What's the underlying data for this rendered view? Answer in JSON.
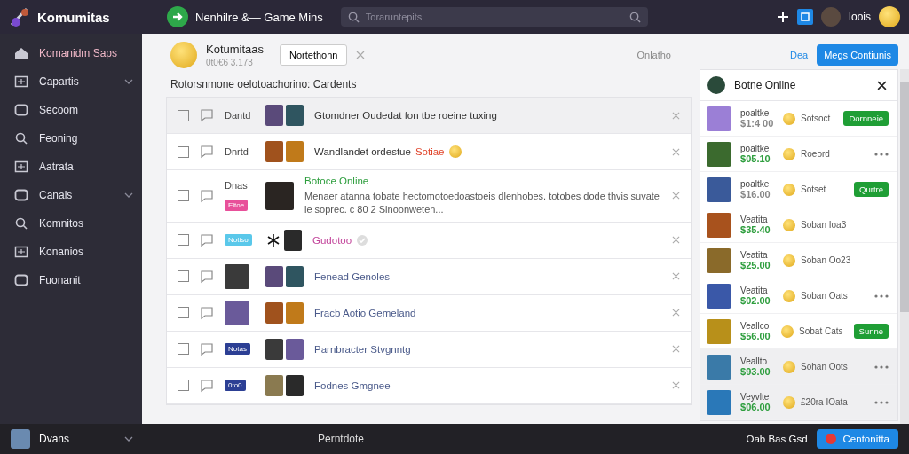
{
  "topbar": {
    "brand": "Komumitas",
    "title": "Nenhilre &— Game Mins",
    "search": {
      "placeholder": "Toraruntepits"
    },
    "user": "Ioois"
  },
  "sidebar": {
    "items": [
      {
        "label": "Komanidm Saps",
        "selected": true,
        "expandable": false
      },
      {
        "label": "Capartis",
        "selected": false,
        "expandable": true
      },
      {
        "label": "Secoom",
        "selected": false,
        "expandable": false
      },
      {
        "label": "Feoning",
        "selected": false,
        "expandable": false
      },
      {
        "label": "Aatrata",
        "selected": false,
        "expandable": false
      },
      {
        "label": "Canais",
        "selected": false,
        "expandable": true
      },
      {
        "label": "Komnitos",
        "selected": false,
        "expandable": false
      },
      {
        "label": "Konanios",
        "selected": false,
        "expandable": false
      },
      {
        "label": "Fuonanit",
        "selected": false,
        "expandable": false
      }
    ]
  },
  "header": {
    "name": "Kotumitaas",
    "subtitle": "0t0€6 3.173",
    "button": "Nortethonn",
    "status": "Onlatho",
    "link": "Dea",
    "primary_button": "Megs Contiunis",
    "description": "Rotorsnmone oelotoachorino: Cardents"
  },
  "rows": [
    {
      "selected": true,
      "checked": false,
      "label": "Dantd",
      "thumbs": [
        {
          "kind": "photo"
        },
        {
          "kind": "photo"
        }
      ],
      "title": "Gtomdner Oudedat fon tbe roeine tuxing",
      "color": "#333333"
    },
    {
      "selected": false,
      "checked": false,
      "label": "Dnrtd",
      "thumbs": [
        {
          "kind": "photo"
        },
        {
          "kind": "photo"
        }
      ],
      "title": "Wandlandet ordestue",
      "highlight": "Sotiae",
      "badge": {
        "kind": "coin"
      },
      "color": "#333333"
    },
    {
      "selected": false,
      "checked": false,
      "label": "Dnas",
      "tag": {
        "text": "Eltoe",
        "color": "#e8509a"
      },
      "thumbs": [
        {
          "kind": "portrait"
        }
      ],
      "title": "Botoce Online",
      "description": "Menaer atanna tobate hectomotoedoastoeis dlenhobes. totobes dode thvis suvate le soprec. c 80 2 Slnoonweten...",
      "color": "#2e9e3e"
    },
    {
      "selected": false,
      "checked": false,
      "tag": {
        "text": "Notiso",
        "color": "#5ac8ea"
      },
      "thumbs": [
        {
          "kind": "asterisk"
        },
        {
          "kind": "photo"
        }
      ],
      "title": "Gudotoo",
      "badge": {
        "kind": "check"
      },
      "color": "#c2439a"
    },
    {
      "selected": false,
      "checked": false,
      "avatar": true,
      "thumbs": [
        {
          "kind": "photo"
        },
        {
          "kind": "photo"
        }
      ],
      "title": "Fenead Genoles",
      "color": "#4a5a8a"
    },
    {
      "selected": false,
      "checked": false,
      "avatar": true,
      "thumbs": [
        {
          "kind": "photo"
        },
        {
          "kind": "photo"
        }
      ],
      "title": "Fracb Aotio Gemeland",
      "color": "#4a5a8a"
    },
    {
      "selected": false,
      "checked": false,
      "tag": {
        "text": "Notas",
        "color": "#2c3f94"
      },
      "thumbs": [
        {
          "kind": "photo"
        },
        {
          "kind": "photo"
        }
      ],
      "title": "Parnbracter Stvgnntg",
      "color": "#4a5a8a"
    },
    {
      "selected": false,
      "checked": false,
      "tag": {
        "text": "0to0",
        "color": "#2c3f94"
      },
      "thumbs": [
        {
          "kind": "photo"
        },
        {
          "kind": "photo"
        }
      ],
      "title": "Fodnes Gmgnee",
      "color": "#4a5a8a"
    }
  ],
  "panel": {
    "title": "Botne Online",
    "items": [
      {
        "name": "poaltke",
        "price": "$1:4 00",
        "color": "#888888",
        "coin": "Sotsoct",
        "kind": "button",
        "button_label": "Dornneie",
        "highlighted": false
      },
      {
        "name": "poaltke",
        "price": "$05.10",
        "color": "#2e9e3e",
        "coin": "Roeord",
        "kind": "more",
        "highlighted": false
      },
      {
        "name": "poaltke",
        "price": "$16.00",
        "color": "#888888",
        "coin": "Sotset",
        "kind": "button",
        "button_label": "Qurtre",
        "highlighted": false
      },
      {
        "name": "Veatita",
        "price": "$35.40",
        "color": "#2e9e3e",
        "coin": "Soban Ioa3",
        "kind": "plain",
        "highlighted": false
      },
      {
        "name": "Veatita",
        "price": "$25.00",
        "color": "#2e9e3e",
        "coin": "Soban Oo23",
        "kind": "plain",
        "highlighted": false
      },
      {
        "name": "Veatita",
        "price": "$02.00",
        "color": "#2e9e3e",
        "coin": "Soban Oats",
        "kind": "more",
        "highlighted": false
      },
      {
        "name": "Veallco",
        "price": "$56.00",
        "color": "#2e9e3e",
        "coin": "Sobat Cats",
        "kind": "button",
        "button_label": "Sunne",
        "highlighted": false
      },
      {
        "name": "Veallto",
        "price": "$93.00",
        "color": "#2e9e3e",
        "coin": "Sohan Oots",
        "kind": "more",
        "highlighted": true
      },
      {
        "name": "Veyvlte",
        "price": "$06.00",
        "color": "#2e9e3e",
        "coin": "£20ra IOata",
        "kind": "more",
        "highlighted": true
      }
    ]
  },
  "footer": {
    "user": "Dvans",
    "item": "Perntdote",
    "note": "Oab Bas Gsd",
    "button": "Centonitta"
  }
}
